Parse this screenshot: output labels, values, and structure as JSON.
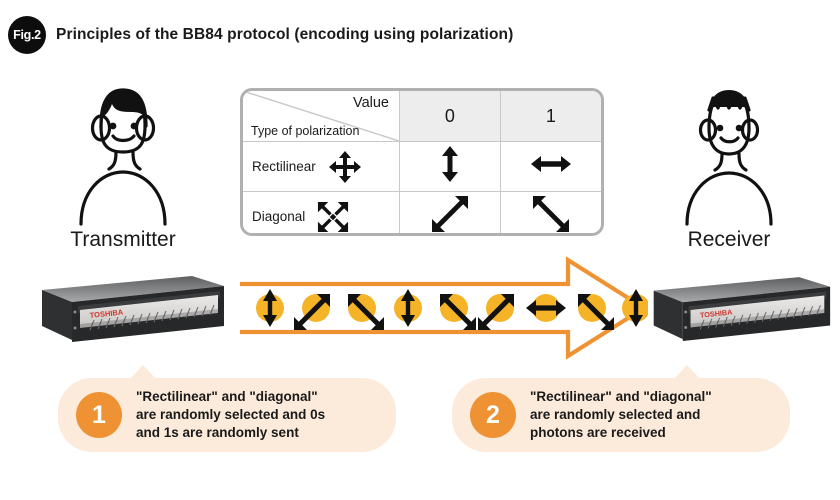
{
  "figure": {
    "badge": "Fig.2",
    "title": "Principles of the BB84 protocol (encoding using polarization)"
  },
  "colors": {
    "accent_orange": "#ef9234",
    "bubble_bg": "#fceadb",
    "photon_yellow": "#f5b327",
    "arrow_black": "#111111",
    "table_border": "#b0b0b0",
    "header_bg": "#ededed",
    "badge_black": "#0d0d0d"
  },
  "actors": {
    "transmitter": {
      "label": "Transmitter",
      "icon": "person-bob-hair-icon"
    },
    "receiver": {
      "label": "Receiver",
      "icon": "person-spiky-hair-icon"
    }
  },
  "devices": {
    "transmitter_unit": {
      "brand": "TOSHIBA",
      "icon": "rack-server-icon"
    },
    "receiver_unit": {
      "brand": "TOSHIBA",
      "icon": "rack-server-icon"
    }
  },
  "table": {
    "corner": {
      "row_header": "Type of\npolarization",
      "col_header": "Value"
    },
    "columns": [
      "0",
      "1"
    ],
    "rows": [
      {
        "label": "Rectilinear",
        "label_icon": "four-way-cross-arrow-icon",
        "cells": [
          {
            "value": "0",
            "icon": "arrow-vertical-icon"
          },
          {
            "value": "1",
            "icon": "arrow-horizontal-icon"
          }
        ]
      },
      {
        "label": "Diagonal",
        "label_icon": "four-way-diagonal-arrow-icon",
        "cells": [
          {
            "value": "0",
            "icon": "arrow-diagonal-up-icon"
          },
          {
            "value": "1",
            "icon": "arrow-diagonal-down-icon"
          }
        ]
      }
    ]
  },
  "channel": {
    "direction": "left-to-right",
    "photons": [
      {
        "index": 1,
        "polarization": "vertical",
        "basis": "rectilinear",
        "bit": "0"
      },
      {
        "index": 2,
        "polarization": "diagonal-up",
        "basis": "diagonal",
        "bit": "0"
      },
      {
        "index": 3,
        "polarization": "diagonal-down",
        "basis": "diagonal",
        "bit": "1"
      },
      {
        "index": 4,
        "polarization": "vertical",
        "basis": "rectilinear",
        "bit": "0"
      },
      {
        "index": 5,
        "polarization": "diagonal-down",
        "basis": "diagonal",
        "bit": "1"
      },
      {
        "index": 6,
        "polarization": "diagonal-up",
        "basis": "diagonal",
        "bit": "0"
      },
      {
        "index": 7,
        "polarization": "horizontal",
        "basis": "rectilinear",
        "bit": "1"
      },
      {
        "index": 8,
        "polarization": "diagonal-down",
        "basis": "diagonal",
        "bit": "1"
      },
      {
        "index": 9,
        "polarization": "vertical",
        "basis": "rectilinear",
        "bit": "0"
      }
    ]
  },
  "captions": [
    {
      "number": "1",
      "text": "\"Rectilinear\" and \"diagonal\"\nare randomly selected and 0s\nand 1s are randomly sent"
    },
    {
      "number": "2",
      "text": "\"Rectilinear\" and \"diagonal\"\nare randomly selected and\nphotons are received"
    }
  ]
}
